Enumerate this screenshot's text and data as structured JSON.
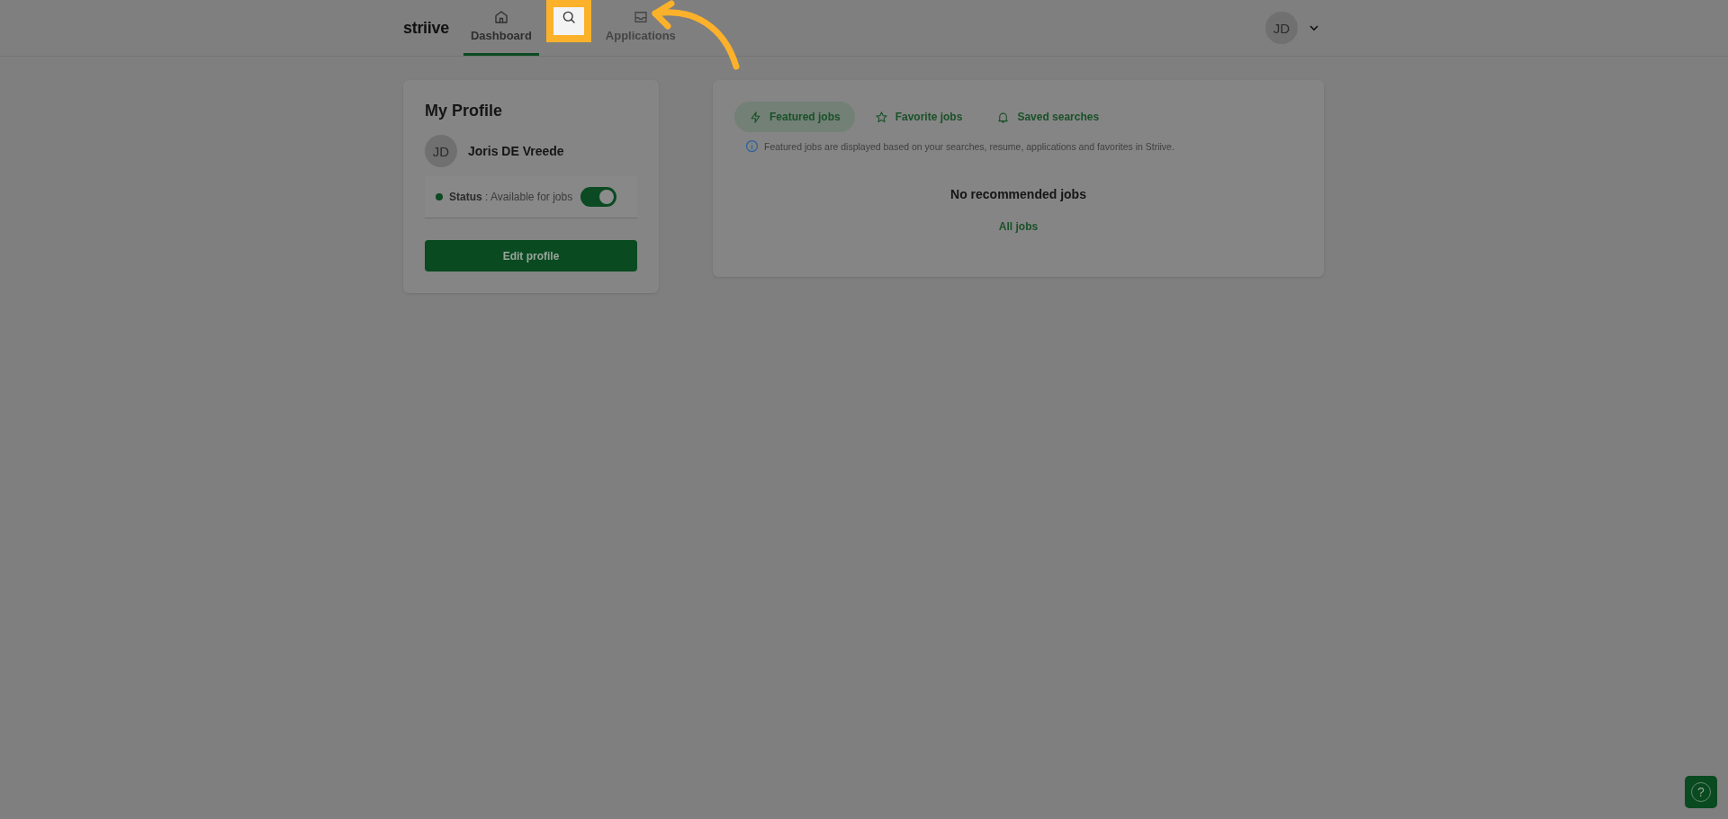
{
  "header": {
    "logo": "striive",
    "nav": [
      {
        "label": "Dashboard",
        "selected": true,
        "highlighted": false
      },
      {
        "selected": false,
        "highlighted": true
      },
      {
        "label": "Applications",
        "selected": false,
        "highlighted": false
      }
    ],
    "user": {
      "initials": "JD"
    }
  },
  "profile": {
    "title": "My Profile",
    "initials": "JD",
    "name": "Joris DE Vreede",
    "status": "**Status** : Available for jobs",
    "available": true,
    "edit_button": "Edit profile"
  },
  "jobs": {
    "tabs": [
      {
        "label": "Featured jobs",
        "selected": true
      },
      {
        "label": "Favorite jobs",
        "selected": false
      },
      {
        "label": "Saved searches",
        "selected": false
      }
    ],
    "info": "Featured jobs are displayed based on your searches, resume, applications and favorites in Striive.",
    "empty_title": "No recommended jobs",
    "link": "All jobs"
  },
  "help": "?"
}
